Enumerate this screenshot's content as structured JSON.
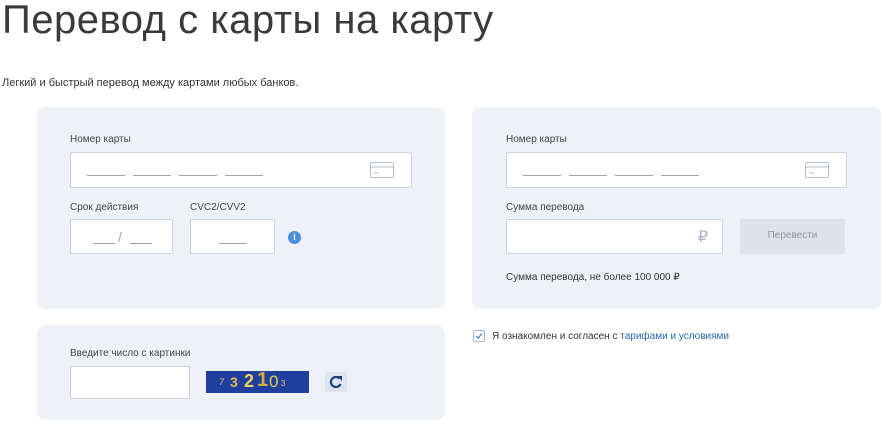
{
  "page": {
    "title": "Перевод с карты на карту",
    "subtitle": "Легкий и быстрый перевод между картами любых банков."
  },
  "sender": {
    "card_number_label": "Номер карты",
    "card_number_value": "",
    "expiry_label": "Срок действия",
    "expiry_separator": "/",
    "cvc_label": "CVC2/CVV2"
  },
  "recipient": {
    "card_number_label": "Номер карты",
    "card_number_value": "",
    "amount_label": "Сумма перевода",
    "amount_value": "",
    "currency_symbol": "₽",
    "transfer_button_label": "Перевести",
    "amount_hint": "Сумма перевода, не более 100 000 ₽"
  },
  "captcha": {
    "label": "Введите число с картинки",
    "input_value": "",
    "image_digits": [
      "7",
      "3",
      "2",
      "1",
      "0",
      "3"
    ]
  },
  "agreement": {
    "checked": true,
    "text_prefix": "Я ознакомлен и согласен с ",
    "link_text": "тарифами и условиями"
  },
  "colors": {
    "panel_bg": "#eef2f8",
    "link": "#2a6bb5",
    "info_icon": "#4a90d9",
    "captcha_bg": "#1f3f9e",
    "button_bg": "#dfe2e7"
  },
  "icons": {
    "card": "card-icon",
    "info": "info-icon",
    "refresh": "refresh-icon",
    "check": "checkmark-icon"
  }
}
